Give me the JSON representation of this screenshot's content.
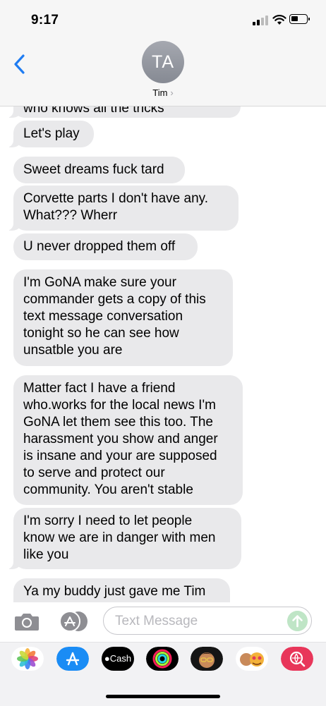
{
  "status": {
    "time": "9:17"
  },
  "header": {
    "avatar_initials": "TA",
    "contact_name": "Tim",
    "contact_chevron": "›"
  },
  "messages": [
    {
      "text": "who knows all the tricks"
    },
    {
      "text": "Let's play"
    },
    {
      "text": "Sweet dreams fuck tard"
    },
    {
      "text": "Corvette parts I don't have any.\nWhat??? Wherr"
    },
    {
      "text": "U never dropped them off"
    },
    {
      "text": "I'm GoNA make sure your\ncommander gets a copy of this\ntext message conversation\ntonight so he can see how\nunsatble you are"
    },
    {
      "text": "Matter fact I have a friend\nwho.works for the local news I'm\nGoNA let them see this too. The\nharassment you show and anger\nis insane and your are supposed\nto serve and protect our\ncommunity. You aren't stable"
    },
    {
      "text": "I'm sorry I need to let people\nknow we are in danger with men\nlike you"
    },
    {
      "text": "Ya my buddy just gave me Tim"
    }
  ],
  "input": {
    "placeholder": "Text Message",
    "value": ""
  },
  "app_strip": {
    "cash_label": "Cash",
    "apps": [
      "photos-app-icon",
      "app-store-icon",
      "cash-app-icon",
      "activity-app-icon",
      "memoji-app-icon",
      "animoji-app-icon",
      "search-images-app-icon"
    ]
  },
  "colors": {
    "accent_blue": "#1e7cf2",
    "bubble_gray": "#e9e9eb",
    "send_green": "#bfe5c6"
  }
}
